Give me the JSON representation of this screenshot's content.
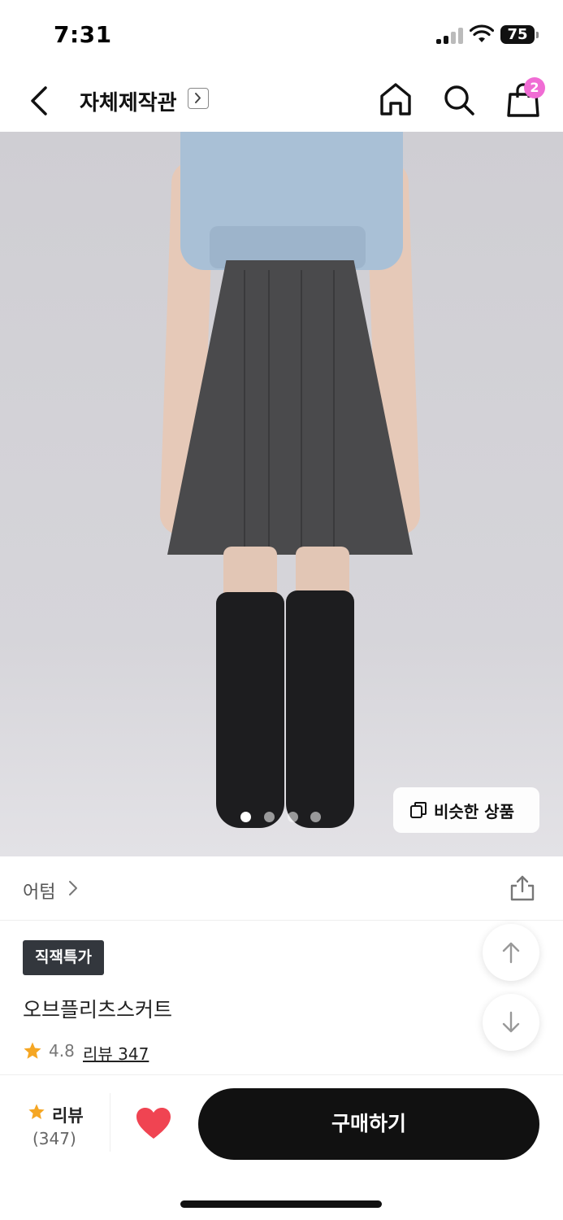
{
  "status_bar": {
    "time": "7:31",
    "battery": "75"
  },
  "header": {
    "store_title": "자체제작관",
    "cart_count": "2"
  },
  "hero": {
    "similar_label": "비슷한 상품",
    "slide_count": 4,
    "active_slide": 1
  },
  "brand": {
    "name": "어텀"
  },
  "product": {
    "badge": "직잭특가",
    "name": "오브플리츠스커트",
    "rating": "4.8",
    "review_link": "리뷰 347"
  },
  "bottom_bar": {
    "review_label": "리뷰",
    "review_count": "(347)",
    "buy_label": "구매하기"
  },
  "colors": {
    "accent_badge": "#f06cd4",
    "star": "#f5a623",
    "heart": "#f04452",
    "buy_button": "#111111"
  },
  "icons": [
    "back-arrow-icon",
    "chevron-right-icon",
    "home-icon",
    "search-icon",
    "shopping-bag-icon",
    "copy-icon",
    "share-icon",
    "star-icon",
    "arrow-up-icon",
    "arrow-down-icon",
    "heart-icon"
  ]
}
